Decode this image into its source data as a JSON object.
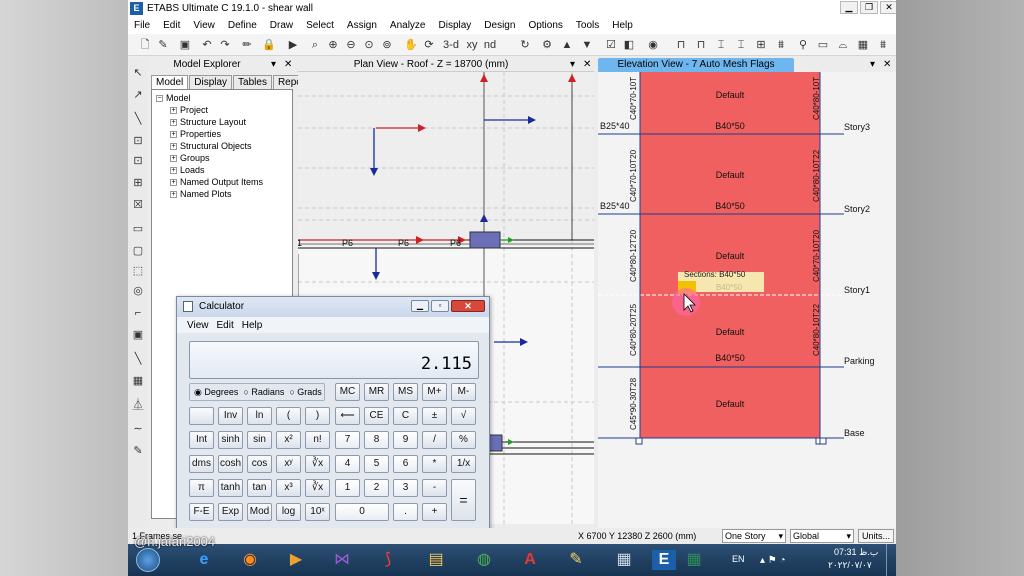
{
  "window": {
    "title": "ETABS Ultimate C 19.1.0 - shear wall",
    "logo": "E",
    "controls": [
      "▁",
      "❐",
      "✕"
    ]
  },
  "menu": [
    "File",
    "Edit",
    "View",
    "Define",
    "Draw",
    "Select",
    "Assign",
    "Analyze",
    "Display",
    "Design",
    "Options",
    "Tools",
    "Help"
  ],
  "toolbar": {
    "items": [
      "new-icon",
      "open-icon",
      "save-icon",
      "undo-icon",
      "redo-icon",
      "lock-icon",
      "pencil-icon",
      "run-icon",
      "zoom-icon",
      "zoom-in-icon",
      "zoom-out-icon",
      "zoom-window-icon",
      "pan-icon",
      "rotate-icon",
      "3d-view-icon",
      "plan-icon",
      "elevation-icon",
      "up-icon",
      "down-icon",
      "check-icon",
      "options-icon",
      "object-icon",
      "wall-icon",
      "beam-icon",
      "column-icon",
      "brace-icon",
      "slab-icon",
      "load-icon",
      "frame-icon"
    ],
    "labels": {
      "3d": "3-d",
      "xy": "xy",
      "nd": "nd"
    }
  },
  "explorer": {
    "title": "Model Explorer",
    "tabs": [
      "Model",
      "Display",
      "Tables",
      "Reports"
    ],
    "root": "Model",
    "items": [
      "Project",
      "Structure Layout",
      "Properties",
      "Structural Objects",
      "Groups",
      "Loads",
      "Named Output Items",
      "Named Plots"
    ]
  },
  "plan": {
    "title": "Plan View - Roof - Z = 18700 (mm)",
    "labels": [
      "P6",
      "P6",
      "P6"
    ],
    "edge_label": "1"
  },
  "elevation": {
    "title": "Elevation View - 7  Auto Mesh Flags",
    "panel_label": "Default",
    "beam_label": "B40*50",
    "left_beam": "B25*40",
    "stories": [
      "Story3",
      "Story2",
      "Story1",
      "Parking",
      "Base"
    ],
    "left_columns": [
      "C40*70-10T",
      "C40*70-10T20",
      "C40*80-12T20",
      "C40*80-20T25",
      "C45*90-30T28"
    ],
    "right_columns": [
      "C40*80-10T",
      "C40*80-10T22",
      "C40*70-10T20",
      "C40*80-10T22"
    ],
    "tooltip": "Sections: B40*50",
    "tooltip_ghost": "B40*50"
  },
  "calculator": {
    "title": "Calculator",
    "menu": [
      "View",
      "Edit",
      "Help"
    ],
    "display": "2.115",
    "modes": [
      "Degrees",
      "Radians",
      "Grads"
    ],
    "memory": [
      "MC",
      "MR",
      "MS",
      "M+",
      "M-"
    ],
    "rows": [
      [
        "",
        "Inv",
        "ln",
        "(",
        ")",
        "⟵",
        "CE",
        "C",
        "±",
        "√"
      ],
      [
        "Int",
        "sinh",
        "sin",
        "x²",
        "n!",
        "7",
        "8",
        "9",
        "/",
        "%"
      ],
      [
        "dms",
        "cosh",
        "cos",
        "xʸ",
        "∛x",
        "4",
        "5",
        "6",
        "*",
        "1/x"
      ],
      [
        "π",
        "tanh",
        "tan",
        "x³",
        "∛x",
        "1",
        "2",
        "3",
        "-",
        ""
      ],
      [
        "F-E",
        "Exp",
        "Mod",
        "log",
        "10ˣ",
        "0",
        "",
        ".",
        "+",
        ""
      ]
    ],
    "equals": "="
  },
  "status": {
    "left": "1 Frames se",
    "coords": "X 6700  Y 12380  Z 2600 (mm)",
    "story_select": "One Story",
    "coord_select": "Global",
    "units": "Units..."
  },
  "taskbar": {
    "items": [
      "start-orb",
      "ie-icon",
      "firefox-icon",
      "media-player-icon",
      "visual-studio-icon",
      "acrobat-icon",
      "explorer-icon",
      "chrome-icon",
      "autocad-icon",
      "paint-icon",
      "calculator-icon",
      "etabs-icon",
      "excel-icon"
    ],
    "lang": "EN",
    "time": "07:31 ب.ظ",
    "date": "۲۰۲۲/۰۷/۰۷"
  },
  "watermark": "@h.jafari2004",
  "colors": {
    "wall": "#f06060",
    "grid": "#1e3d8f",
    "arrow_red": "#cc2222",
    "arrow_blue": "#1a2a9a",
    "arrow_green": "#20a020",
    "titlebar_active": "#6fb6ef",
    "highlight": "#f2c200"
  }
}
